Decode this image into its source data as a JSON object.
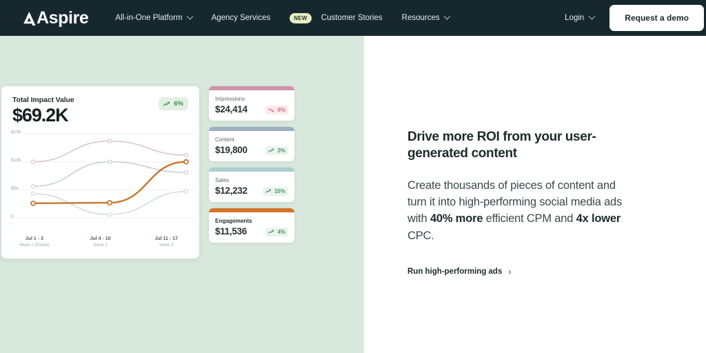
{
  "nav": {
    "logo_text": "Aspire",
    "items": [
      {
        "label": "All-in-One Platform",
        "has_chevron": true,
        "badge": null
      },
      {
        "label": "Agency Services",
        "has_chevron": false,
        "badge": null
      },
      {
        "label": "Customer Stories",
        "has_chevron": false,
        "badge": "NEW"
      },
      {
        "label": "Resources",
        "has_chevron": true,
        "badge": null
      }
    ],
    "login_label": "Login",
    "demo_button": "Request a demo"
  },
  "chart_card": {
    "title": "Total Impact Value",
    "value": "$69.2K",
    "trend_badge": {
      "text": "6%",
      "direction": "up",
      "icon": "trend-up-icon"
    }
  },
  "chart_data": {
    "type": "line",
    "title": "Total Impact Value",
    "xlabel": "",
    "ylabel": "",
    "grid": true,
    "legend": "none",
    "categories": [
      "Jul 1 - 3",
      "Jul 4 - 10",
      "Jul 11 - 17"
    ],
    "category_sublabels": [
      "Week 1 (Partial)",
      "Week 2",
      "Week 3"
    ],
    "ytick_labels": [
      "$15k",
      "$10k",
      "$5k",
      "0"
    ],
    "ytick_values": [
      15000,
      10000,
      5000,
      0
    ],
    "ylim": [
      0,
      15000
    ],
    "series": [
      {
        "name": "Impressions",
        "color": "#d8c3cc",
        "values": [
          10000,
          13700,
          11200
        ]
      },
      {
        "name": "Content",
        "color": "#c3cfd8",
        "values": [
          5600,
          10000,
          8100
        ]
      },
      {
        "name": "Sales",
        "color": "#cfdcdb",
        "values": [
          4300,
          600,
          4700
        ]
      },
      {
        "name": "Engagements",
        "color": "#c8762c",
        "values": [
          2600,
          2700,
          10000
        ],
        "emphasis": true
      }
    ]
  },
  "metrics": [
    {
      "label": "Impressions",
      "value": "$24,414",
      "bar_color": "#cf93ab",
      "change": "6%",
      "direction": "down",
      "icon": "trend-down-icon",
      "strong": false
    },
    {
      "label": "Content",
      "value": "$19,800",
      "bar_color": "#9db0c0",
      "change": "3%",
      "direction": "up",
      "icon": "trend-up-icon",
      "strong": false
    },
    {
      "label": "Sales",
      "value": "$12,232",
      "bar_color": "#a9cfd1",
      "change": "10%",
      "direction": "up",
      "icon": "trend-up-icon",
      "strong": false
    },
    {
      "label": "Engagements",
      "value": "$11,536",
      "bar_color": "#d4742a",
      "change": "4%",
      "direction": "up",
      "icon": "trend-up-icon",
      "strong": true
    }
  ],
  "content": {
    "headline": "Drive more ROI from your user-generated content",
    "body_part_1": "Create thousands of pieces of content and turn it into high-performing social media ads with ",
    "body_bold_1": "40% more",
    "body_part_2": " efficient CPM and ",
    "body_bold_2": "4x lower",
    "body_part_3": " CPC.",
    "cta_label": "Run high-performing ads",
    "cta_arrow": "›"
  },
  "colors": {
    "nav_bg": "#16282e",
    "left_panel_bg": "#d9e8dc",
    "accent_orange": "#c8762c",
    "badge_green_bg": "#e2f0e4",
    "badge_green_text": "#3d8b55",
    "new_badge_bg": "#e7eec3"
  }
}
